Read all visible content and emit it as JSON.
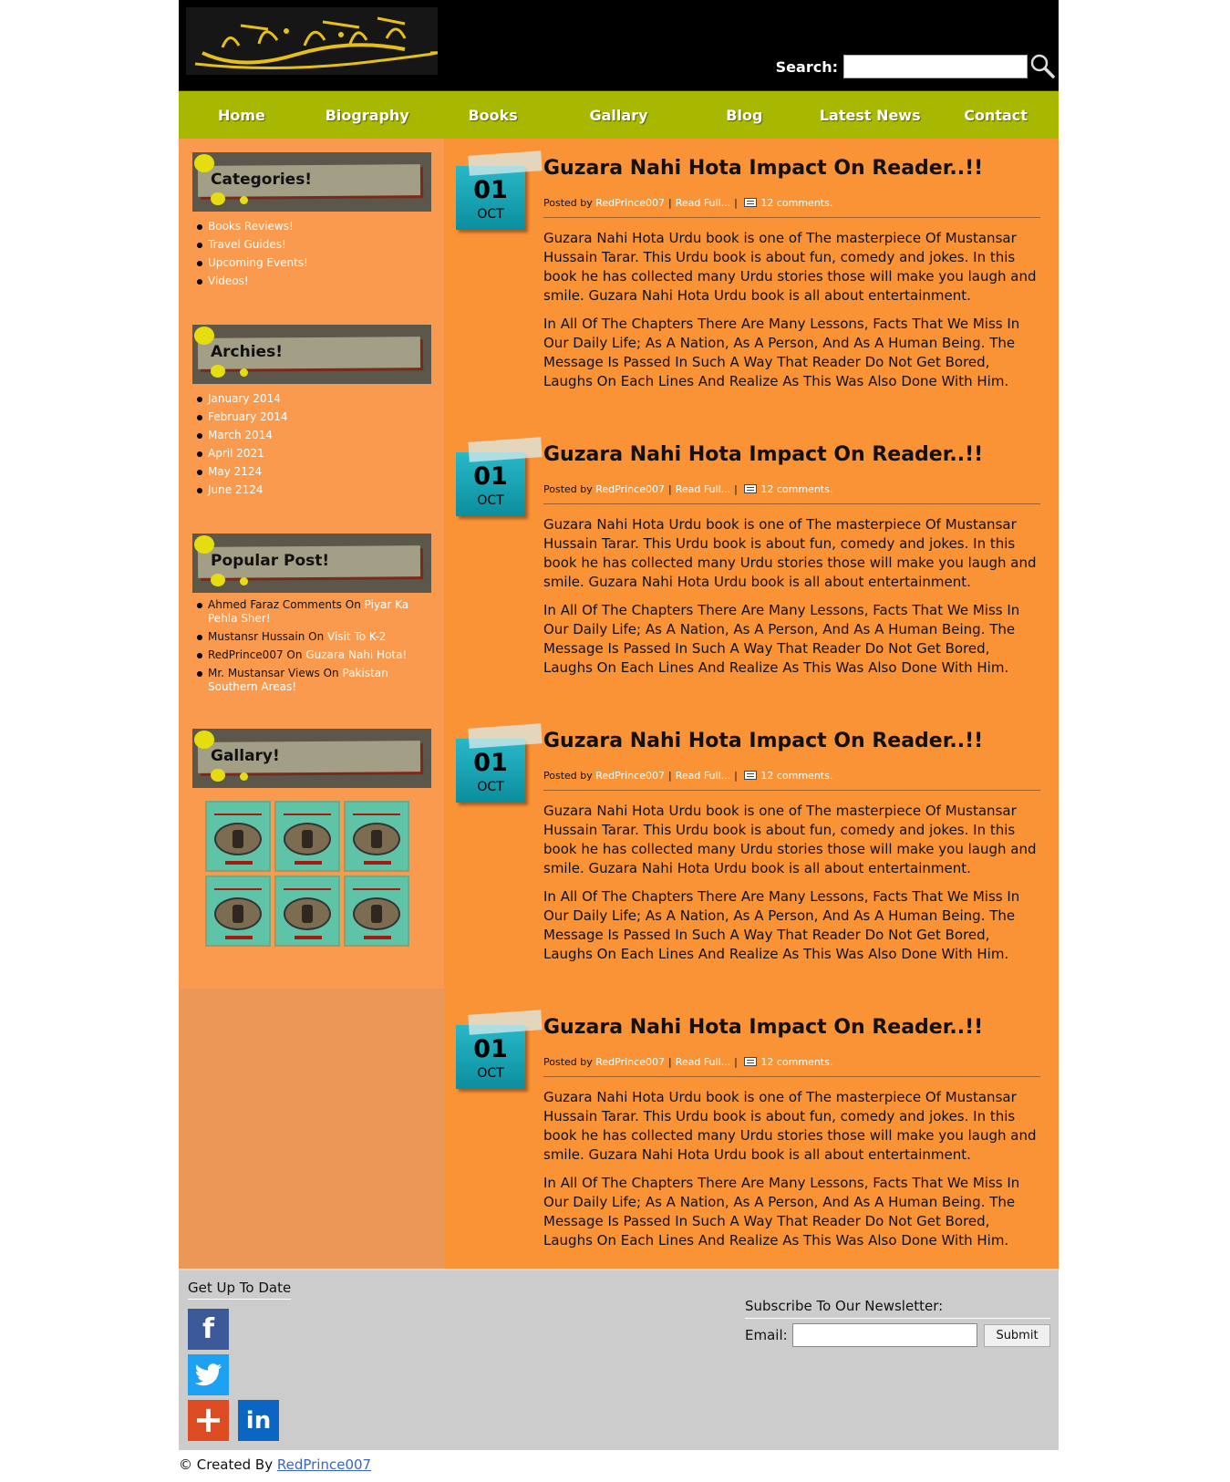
{
  "header": {
    "search_label": "Search:",
    "search_value": "",
    "colors": {
      "background": "#000000",
      "logo_text": "#e6c015"
    }
  },
  "nav": {
    "items": [
      {
        "label": "Home"
      },
      {
        "label": "Biography"
      },
      {
        "label": "Books"
      },
      {
        "label": "Gallary"
      },
      {
        "label": "Blog"
      },
      {
        "label": "Latest News"
      },
      {
        "label": "Contact"
      }
    ],
    "color": "#a8b800"
  },
  "sidebar": {
    "categories": {
      "title": "Categories!",
      "items": [
        "Books Reviews!",
        "Travel Guides!",
        "Upcoming Events!",
        "Videos!"
      ]
    },
    "archives": {
      "title": "Archies!",
      "items": [
        "January 2014",
        "February 2014",
        "March 2014",
        "April 2021",
        "May 2124",
        "June 2124"
      ]
    },
    "popular": {
      "title": "Popular Post!",
      "items": [
        {
          "who": "Ahmed Faraz Comments",
          "on": "On",
          "link": "Piyar Ka Pehla Sher!"
        },
        {
          "who": "Mustansr Hussain",
          "on": "On",
          "link": "Visit To K-2"
        },
        {
          "who": "RedPrince007",
          "on": "On",
          "link": "Guzara Nahi Hota!"
        },
        {
          "who": "Mr. Mustansar Views",
          "on": "On",
          "link": "Pakistan Southern Areas!"
        }
      ]
    },
    "gallery": {
      "title": "Gallary!",
      "thumb_count": 6
    }
  },
  "posts": [
    {
      "day": "01",
      "month": "OCT",
      "title": "Guzara Nahi Hota Impact On Reader..!!",
      "posted_by_label": "Posted by",
      "author": "RedPrince007",
      "read_more": "Read Full...",
      "comments": "12 comments.",
      "para1": "Guzara Nahi Hota Urdu book is one of The masterpiece Of Mustansar Hussain Tarar. This Urdu book is about fun, comedy and jokes. In this book he has collected many Urdu stories those will make you laugh and smile. Guzara Nahi Hota Urdu book is all about entertainment.",
      "para2": "In All Of The Chapters There Are Many Lessons, Facts That We Miss In Our Daily Life; As A Nation, As A Person, And As A Human Being. The Message Is Passed In Such A Way That Reader Do Not Get Bored, Laughs On Each Lines And Realize As This Was Also Done With Him."
    },
    {
      "day": "01",
      "month": "OCT",
      "title": "Guzara Nahi Hota Impact On Reader..!!",
      "posted_by_label": "Posted by",
      "author": "RedPrince007",
      "read_more": "Read Full...",
      "comments": "12 comments.",
      "para1": "Guzara Nahi Hota Urdu book is one of The masterpiece Of Mustansar Hussain Tarar. This Urdu book is about fun, comedy and jokes. In this book he has collected many Urdu stories those will make you laugh and smile. Guzara Nahi Hota Urdu book is all about entertainment.",
      "para2": "In All Of The Chapters There Are Many Lessons, Facts That We Miss In Our Daily Life; As A Nation, As A Person, And As A Human Being. The Message Is Passed In Such A Way That Reader Do Not Get Bored, Laughs On Each Lines And Realize As This Was Also Done With Him."
    },
    {
      "day": "01",
      "month": "OCT",
      "title": "Guzara Nahi Hota Impact On Reader..!!",
      "posted_by_label": "Posted by",
      "author": "RedPrince007",
      "read_more": "Read Full...",
      "comments": "12 comments.",
      "para1": "Guzara Nahi Hota Urdu book is one of The masterpiece Of Mustansar Hussain Tarar. This Urdu book is about fun, comedy and jokes. In this book he has collected many Urdu stories those will make you laugh and smile. Guzara Nahi Hota Urdu book is all about entertainment.",
      "para2": "In All Of The Chapters There Are Many Lessons, Facts That We Miss In Our Daily Life; As A Nation, As A Person, And As A Human Being. The Message Is Passed In Such A Way That Reader Do Not Get Bored, Laughs On Each Lines And Realize As This Was Also Done With Him."
    },
    {
      "day": "01",
      "month": "OCT",
      "title": "Guzara Nahi Hota Impact On Reader..!!",
      "posted_by_label": "Posted by",
      "author": "RedPrince007",
      "read_more": "Read Full...",
      "comments": "12 comments.",
      "para1": "Guzara Nahi Hota Urdu book is one of The masterpiece Of Mustansar Hussain Tarar. This Urdu book is about fun, comedy and jokes. In this book he has collected many Urdu stories those will make you laugh and smile. Guzara Nahi Hota Urdu book is all about entertainment.",
      "para2": "In All Of The Chapters There Are Many Lessons, Facts That We Miss In Our Daily Life; As A Nation, As A Person, And As A Human Being. The Message Is Passed In Such A Way That Reader Do Not Get Bored, Laughs On Each Lines And Realize As This Was Also Done With Him."
    }
  ],
  "footer": {
    "title": "Get Up To Date",
    "social": [
      {
        "icon": "facebook-icon",
        "glyph": "f",
        "color": "#3b5998"
      },
      {
        "icon": "twitter-icon",
        "glyph": "t",
        "color": "#1da1f2"
      },
      {
        "icon": "plus-icon",
        "glyph": "+",
        "color": "#dd4b22"
      },
      {
        "icon": "linkedin-icon",
        "glyph": "in",
        "color": "#0a66c2"
      }
    ],
    "newsletter_label": "Subscribe To Our Newsletter:",
    "email_label": "Email:",
    "email_value": "",
    "submit_label": "Submit"
  },
  "credit": {
    "prefix": "© Created By",
    "link": "RedPrince007"
  }
}
